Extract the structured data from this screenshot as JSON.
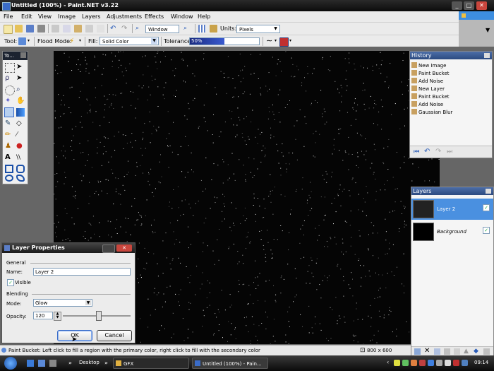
{
  "window": {
    "title": "Untitled (100%) - Paint.NET v3.22"
  },
  "menu": [
    "File",
    "Edit",
    "View",
    "Image",
    "Layers",
    "Adjustments",
    "Effects",
    "Window",
    "Help"
  ],
  "toolbar": {
    "zoom_value": "Window",
    "units_label": "Units:",
    "units_value": "Pixels"
  },
  "tool_options": {
    "tool_label": "Tool:",
    "flood_mode_label": "Flood Mode:",
    "fill_label": "Fill:",
    "fill_value": "Solid Color",
    "tolerance_label": "Tolerance:",
    "tolerance_value": "50%",
    "tolerance_fraction": 0.5
  },
  "tools_panel": {
    "title": "To..."
  },
  "history": {
    "title": "History",
    "items": [
      "New Image",
      "Paint Bucket",
      "Add Noise",
      "New Layer",
      "Paint Bucket",
      "Add Noise",
      "Gaussian Blur"
    ]
  },
  "layers": {
    "title": "Layers",
    "items": [
      {
        "name": "Layer 2",
        "selected": true,
        "visible": true
      },
      {
        "name": "Background",
        "selected": false,
        "visible": true
      }
    ]
  },
  "dialog": {
    "title": "Layer Properties",
    "general_label": "General",
    "name_label": "Name:",
    "name_value": "Layer 2",
    "visible_label": "Visible",
    "blending_label": "Blending",
    "mode_label": "Mode:",
    "mode_value": "Glow",
    "opacity_label": "Opacity:",
    "opacity_value": "120",
    "ok_label": "OK",
    "cancel_label": "Cancel"
  },
  "status": {
    "message": "Paint Bucket: Left click to fill a region with the primary color, right click to fill with the secondary color",
    "size": "800 x 600"
  },
  "taskbar": {
    "desktop_label": "Desktop",
    "folder_label": "GFX",
    "app_label": "Untitled (100%) - Pain...",
    "clock": "09:14"
  },
  "colors": {
    "accent": "#3d8ee0",
    "canvas": "#050505",
    "selected_layer": "#4a90e0"
  }
}
